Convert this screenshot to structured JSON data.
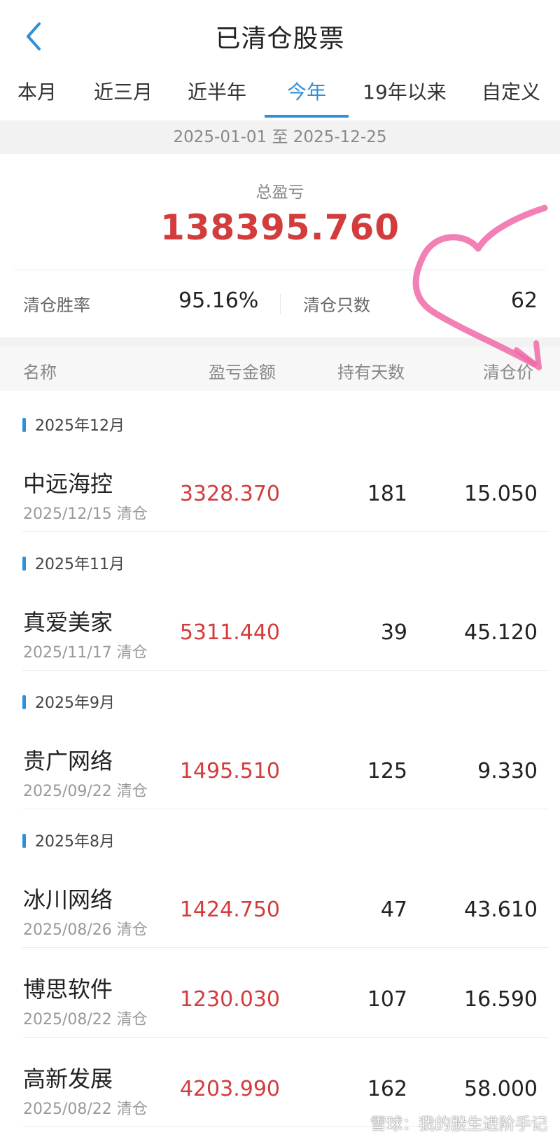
{
  "header": {
    "title": "已清仓股票",
    "back_icon": "chevron-left-icon",
    "accent": "#2f8fd8"
  },
  "tabs": [
    {
      "label": "本月",
      "active": false
    },
    {
      "label": "近三月",
      "active": false
    },
    {
      "label": "近半年",
      "active": false
    },
    {
      "label": "今年",
      "active": true
    },
    {
      "label": "19年以来",
      "active": false
    },
    {
      "label": "自定义",
      "active": false
    }
  ],
  "date_range": "2025-01-01 至 2025-12-25",
  "summary": {
    "total_label": "总盈亏",
    "total_value": "138395.760",
    "win_rate_label": "清仓胜率",
    "win_rate_value": "95.16%",
    "count_label": "清仓只数",
    "count_value": "62"
  },
  "columns": {
    "name": "名称",
    "pnl": "盈亏金额",
    "days": "持有天数",
    "price": "清仓价"
  },
  "groups": [
    {
      "month": "2025年12月",
      "items": [
        {
          "name": "中远海控",
          "date": "2025/12/15 清仓",
          "pnl": "3328.370",
          "days": "181",
          "price": "15.050"
        }
      ]
    },
    {
      "month": "2025年11月",
      "items": [
        {
          "name": "真爱美家",
          "date": "2025/11/17 清仓",
          "pnl": "5311.440",
          "days": "39",
          "price": "45.120"
        }
      ]
    },
    {
      "month": "2025年9月",
      "items": [
        {
          "name": "贵广网络",
          "date": "2025/09/22 清仓",
          "pnl": "1495.510",
          "days": "125",
          "price": "9.330"
        }
      ]
    },
    {
      "month": "2025年8月",
      "items": [
        {
          "name": "冰川网络",
          "date": "2025/08/26 清仓",
          "pnl": "1424.750",
          "days": "47",
          "price": "43.610"
        },
        {
          "name": "博思软件",
          "date": "2025/08/22 清仓",
          "pnl": "1230.030",
          "days": "107",
          "price": "16.590"
        },
        {
          "name": "高新发展",
          "date": "2025/08/22 清仓",
          "pnl": "4203.990",
          "days": "162",
          "price": "58.000"
        }
      ]
    }
  ],
  "watermark": "雪球：我的股生进阶手记",
  "colors": {
    "profit": "#d23c3c",
    "accent": "#2f8fd8",
    "annotation": "#f06aa8"
  }
}
